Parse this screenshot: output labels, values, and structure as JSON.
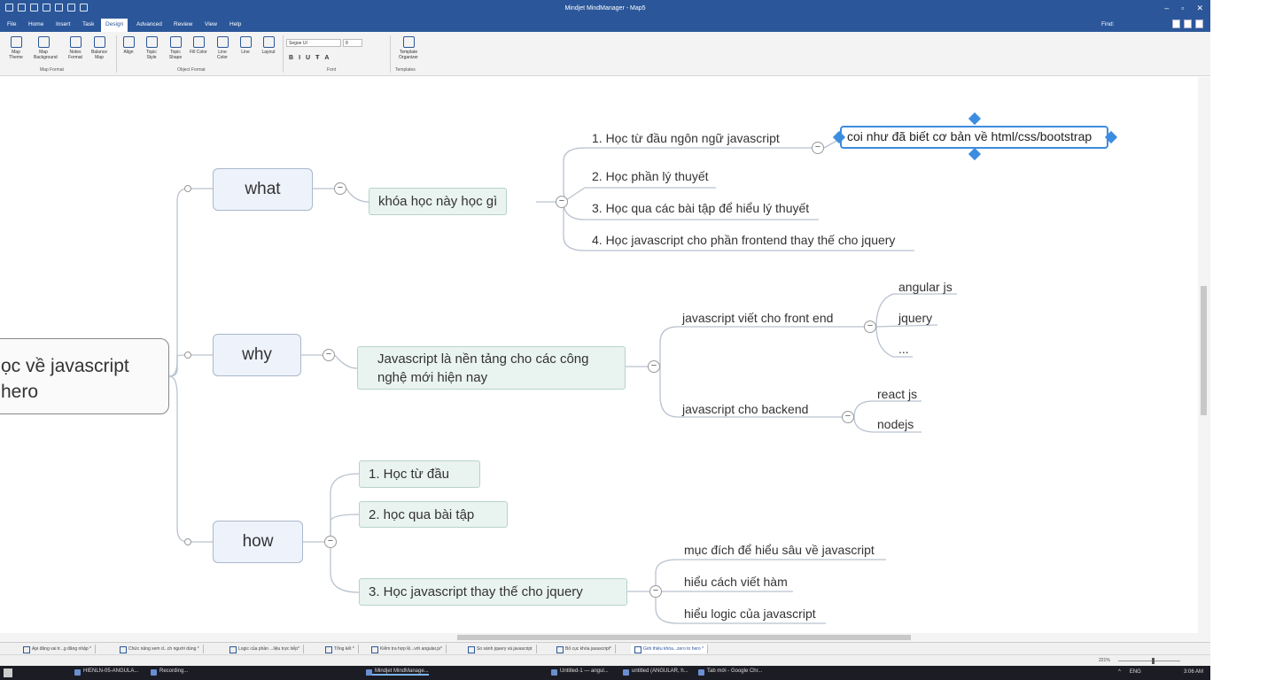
{
  "window": {
    "title": "Mindjet MindManager - Map5",
    "controls": [
      "–",
      "▫",
      "✕"
    ]
  },
  "menu": {
    "tabs": [
      "File",
      "Home",
      "Insert",
      "Task",
      "Design",
      "Advanced",
      "Review",
      "View",
      "Help"
    ],
    "active_tab": "Design",
    "find_label": "Find:"
  },
  "ribbon": {
    "buttons": [
      {
        "label": "Map Theme",
        "icon": "map-theme-icon"
      },
      {
        "label": "Map Background",
        "icon": "map-background-icon"
      },
      {
        "label": "Notes Format",
        "icon": "notes-format-icon"
      },
      {
        "label": "Balance Map",
        "icon": "balance-map-icon"
      },
      {
        "label": "Align",
        "icon": "align-icon"
      },
      {
        "label": "Topic Style",
        "icon": "topic-style-icon"
      },
      {
        "label": "Topic Shape",
        "icon": "topic-shape-icon"
      },
      {
        "label": "Fill Color",
        "icon": "fill-color-icon"
      },
      {
        "label": "Line Color",
        "icon": "line-color-icon"
      },
      {
        "label": "Line",
        "icon": "line-icon"
      },
      {
        "label": "Layout",
        "icon": "layout-icon"
      },
      {
        "label": "Template Organizer",
        "icon": "template-organizer-icon"
      }
    ],
    "groups": [
      "Map Format",
      "Object Format",
      "Font",
      "Templates"
    ],
    "font_name": "Segoe UI",
    "font_size": "8",
    "font_buttons": [
      "B",
      "I",
      "U",
      "Ŧ",
      "A"
    ]
  },
  "map": {
    "central": {
      "line1": "ọc về javascript",
      "line2": "hero"
    },
    "main_topics": {
      "what": "what",
      "why": "why",
      "how": "how"
    },
    "what_branch": {
      "subtopic": "khóa học này học gì",
      "items": [
        "1. Học từ đầu ngôn ngữ javascript",
        "2. Học phần lý thuyết",
        "3. Học qua các bài tập để hiểu lý thuyết",
        "4. Học javascript cho phần frontend thay thế cho jquery"
      ],
      "selected_note": "coi như đã biết cơ bản về html/css/bootstrap"
    },
    "why_branch": {
      "subtopic_line1": "Javascript là nền tảng cho các công",
      "subtopic_line2": "nghệ mới hiện nay",
      "frontend": {
        "label": "javascript viết cho front end",
        "items": [
          "angular js",
          "jquery",
          "..."
        ]
      },
      "backend": {
        "label": "javascript  cho backend",
        "items": [
          "react js",
          "nodejs"
        ]
      }
    },
    "how_branch": {
      "items": [
        "1. Học từ đầu",
        "2. học qua bài tập",
        "3. Học javascript thay thế cho jquery"
      ],
      "sub_items": [
        "mục đích để hiểu sâu về javascript",
        "hiểu cách viết hàm",
        "hiểu logic của javascript"
      ]
    }
  },
  "doc_tabs": [
    "Api đăng vai tr...g đăng nhập *",
    "Chức năng xem d...ch người dùng *",
    "Logic của phần ...liệu trực tiếp*",
    "Tổng kết *",
    "Kiểm tra hợp lệ...với angular.js*",
    "So sánh jquery và javascript",
    "Bố cục khóa javascript*",
    "Giới thiệu khóa...zero to hero *"
  ],
  "active_doc_tab": 7,
  "status": {
    "zoom": "221%"
  },
  "taskbar": {
    "items": [
      "HIENLN-05-ANGULA...",
      "Recording...",
      "Mindjet MindManage...",
      "Untitled-1 — angul...",
      "untitled (ANGULAR, h...",
      "Tab mới - Google Chr..."
    ],
    "language": "ENG",
    "clock": "3:06 AM"
  },
  "colors": {
    "title_bar": "#2b579a",
    "selection": "#3c8ce0",
    "topic_fill": "#eef2fa",
    "subtopic_fill": "#e9f3ef"
  }
}
